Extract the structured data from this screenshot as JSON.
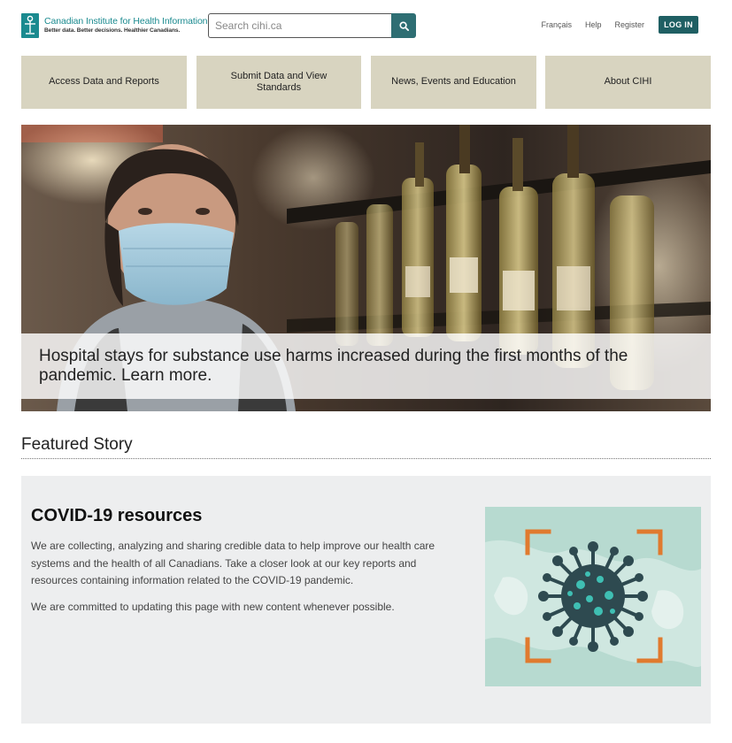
{
  "header": {
    "logo_name": "Canadian Institute for Health Information",
    "logo_tagline": "Better data. Better decisions. Healthier Canadians.",
    "search_placeholder": "Search cihi.ca",
    "search_icon": "search-icon",
    "links": {
      "language": "Français",
      "help": "Help",
      "register": "Register",
      "login": "LOG IN"
    }
  },
  "nav": {
    "items": [
      {
        "label": "Access Data and Reports"
      },
      {
        "label": "Submit Data and View Standards"
      },
      {
        "label": "News, Events and Education"
      },
      {
        "label": "About CIHI"
      }
    ]
  },
  "hero": {
    "caption": "Hospital stays for substance use harms increased during the first months of the pandemic. Learn more."
  },
  "featured": {
    "heading": "Featured Story",
    "card": {
      "title": "COVID-19 resources",
      "paragraph1": "We are collecting, analyzing and sharing credible data to help improve our health care systems and the health of all Canadians. Take a closer look at our key reports and resources containing information related to the COVID-19 pandemic.",
      "paragraph2": "We are committed to updating this page with new content whenever possible.",
      "image_icon": "virus-icon"
    }
  },
  "colors": {
    "brand_teal": "#1a8a8f",
    "dark_teal": "#1f5f63",
    "nav_tile": "#d8d4c0",
    "card_bg": "#edeeef",
    "accent_orange": "#e07a2e"
  }
}
